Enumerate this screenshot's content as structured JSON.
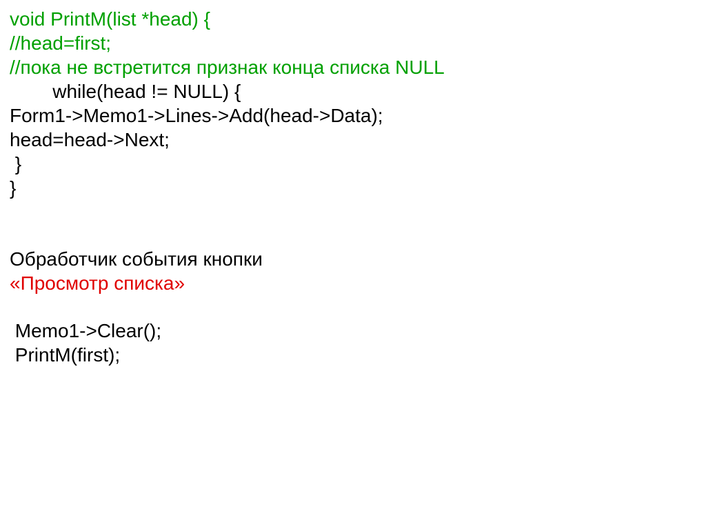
{
  "code": {
    "l1": "void PrintM(list *head) {",
    "l2": "//head=first;",
    "l3": "//пока не встретится признак конца списка NULL",
    "l4": "        while(head != NULL) {",
    "l5": "Form1->Memo1->Lines->Add(head->Data);",
    "l6": "head=head->Next;",
    "l7": " }",
    "l8": "}"
  },
  "heading": {
    "h1": "Обработчик события кнопки",
    "h2": "«Просмотр списка»"
  },
  "snippet": {
    "s1": " Memo1->Clear();",
    "s2": " PrintM(first);"
  }
}
